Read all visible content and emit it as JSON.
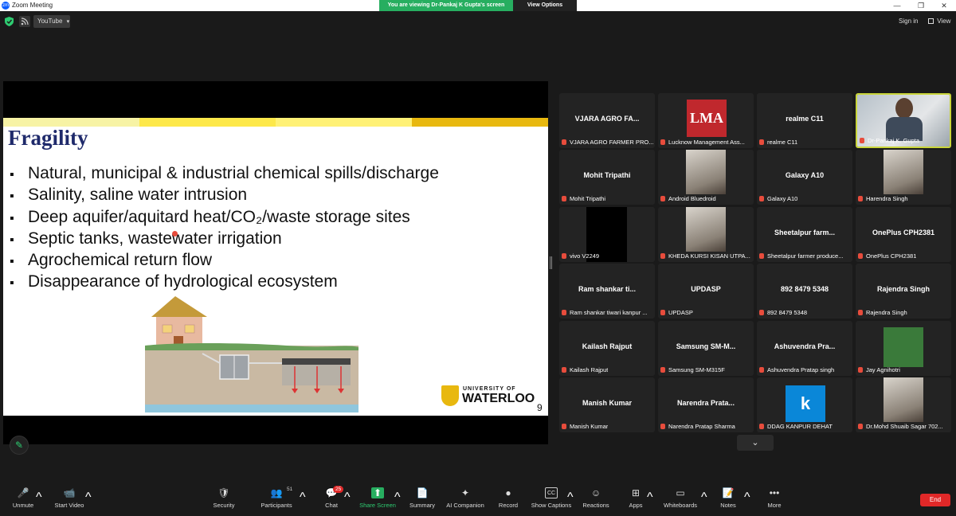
{
  "window": {
    "title": "Zoom Meeting",
    "logo_glyph": "zm",
    "viewing_banner": "You are viewing Dr-Pankaj K Gupta's screen",
    "view_options": "View Options",
    "minimize": "—",
    "maximize": "❐",
    "close": "✕"
  },
  "top_toolbar": {
    "youtube_label": "YouTube",
    "dropdown_glyph": "▾",
    "sign_in": "Sign in",
    "view": "View"
  },
  "slide": {
    "title": "Fragility",
    "bullets": [
      "Natural, municipal & industrial chemical spills/discharge",
      "Salinity, saline water intrusion",
      "Deep aquifer/aquitard heat/CO₂/waste storage sites",
      "Septic tanks, wastewater irrigation",
      "Agrochemical return flow",
      "Disappearance of hydrological ecosystem"
    ],
    "logo_small": "UNIVERSITY OF",
    "logo_big": "WATERLOO",
    "page_number": "9"
  },
  "participants": [
    {
      "big": "VJARA AGRO FA...",
      "name": "VJARA AGRO FARMER PRO..."
    },
    {
      "big": "",
      "name": "Lucknow Management Ass...",
      "img": "lma",
      "img_text": "LMA"
    },
    {
      "big": "realme C11",
      "name": "realme C11"
    },
    {
      "big": "",
      "name": "Dr-Pankaj K. Gupta",
      "img": "video",
      "speaker": true
    },
    {
      "big": "Mohit Tripathi",
      "name": "Mohit Tripathi"
    },
    {
      "big": "",
      "name": "Android Bluedroid",
      "img": "photo"
    },
    {
      "big": "Galaxy A10",
      "name": "Galaxy A10"
    },
    {
      "big": "",
      "name": "Harendra Singh",
      "img": "photo"
    },
    {
      "big": "",
      "name": "vivo V2249",
      "img": "black"
    },
    {
      "big": "",
      "name": "KHEDA KURSI KISAN UTPA...",
      "img": "photo"
    },
    {
      "big": "Sheetalpur  farm...",
      "name": "Sheetalpur farmer produce..."
    },
    {
      "big": "OnePlus CPH2381",
      "name": "OnePlus CPH2381"
    },
    {
      "big": "Ram shankar ti...",
      "name": "Ram shankar tiwari kanpur ..."
    },
    {
      "big": "UPDASP",
      "name": "UPDASP"
    },
    {
      "big": "892 8479 5348",
      "name": "892 8479 5348"
    },
    {
      "big": "Rajendra Singh",
      "name": "Rajendra Singh"
    },
    {
      "big": "Kailash Rajput",
      "name": "Kailash Rajput"
    },
    {
      "big": "Samsung  SM-M...",
      "name": "Samsung SM-M315F"
    },
    {
      "big": "Ashuvendra  Pra...",
      "name": "Ashuvendra Pratap singh"
    },
    {
      "big": "",
      "name": "Jay Agnihotri",
      "img": "green"
    },
    {
      "big": "Manish Kumar",
      "name": "Manish Kumar"
    },
    {
      "big": "Narendra  Prata...",
      "name": "Narendra Pratap Sharma"
    },
    {
      "big": "",
      "name": "DDAG KANPUR DEHAT",
      "img": "kblue",
      "img_text": "k"
    },
    {
      "big": "",
      "name": "Dr.Mohd Shuaib Sagar 702...",
      "img": "photo"
    }
  ],
  "gallery_next_glyph": "⌄",
  "toolbar": {
    "unmute": "Unmute",
    "start_video": "Start Video",
    "security": "Security",
    "participants": "Participants",
    "participants_count": "51",
    "chat": "Chat",
    "chat_badge": "25",
    "share_screen": "Share Screen",
    "summary": "Summary",
    "ai_companion": "AI Companion",
    "record": "Record",
    "show_captions": "Show Captions",
    "cc_glyph": "CC",
    "reactions": "Reactions",
    "apps": "Apps",
    "whiteboards": "Whiteboards",
    "notes": "Notes",
    "more": "More",
    "end": "End",
    "caret_glyph": "^",
    "icons": {
      "unmute": "🎤",
      "start_video": "📹",
      "security": "🛡",
      "participants": "👥",
      "chat": "💬",
      "share_screen": "⬆",
      "summary": "📄",
      "ai_companion": "✦",
      "record": "●",
      "reactions": "☺",
      "apps": "⊞",
      "whiteboards": "▭",
      "notes": "📝",
      "more": "•••",
      "pencil": "✎"
    }
  }
}
